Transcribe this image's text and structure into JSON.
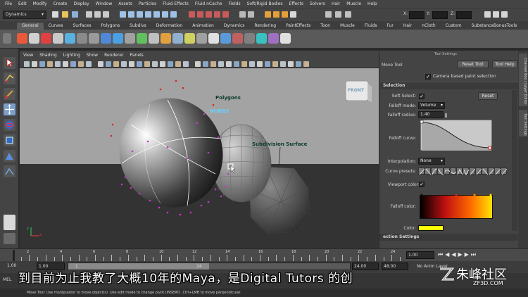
{
  "menubar": [
    "File",
    "Edit",
    "Modify",
    "Create",
    "Display",
    "Window",
    "Assets",
    "Particles",
    "Fluid Effects",
    "Fluid nCache",
    "Fields",
    "Soft/Rigid Bodies",
    "Effects",
    "Solvers",
    "Hair",
    "Muscle",
    "Help"
  ],
  "status": {
    "mode": "Dynamics",
    "x_label": "X:",
    "y_label": "Y:",
    "z_label": "Z:"
  },
  "shelf_tabs": [
    "General",
    "Curves",
    "Surfaces",
    "Polygons",
    "Subdivs",
    "Deformation",
    "Animation",
    "Dynamics",
    "Rendering",
    "PaintEffects",
    "Toon",
    "Muscle",
    "Fluids",
    "Fur",
    "Hair",
    "nCloth",
    "Custom",
    "SubstanceBonusTools"
  ],
  "shelf_active": "General",
  "viewport": {
    "menus": [
      "View",
      "Shading",
      "Lighting",
      "Show",
      "Renderer",
      "Panels"
    ],
    "labels": {
      "polygons": "Polygons",
      "nurbs": "NURBS",
      "subdiv": "Subdivision Surface",
      "cube": "FRONT"
    },
    "colors": {
      "background": "#a3a3a3",
      "ground": "#333333",
      "nurbs_label": "#6ad0ff",
      "label": "#0a3a2a"
    }
  },
  "tool_settings": {
    "panel_title": "Tool Settings",
    "tool_name": "Move Tool",
    "reset_tool": "Reset Tool",
    "tool_help": "Tool Help",
    "camera_based_paint": "Camera based paint selection",
    "section_selection": "Selection",
    "soft_select_label": "Soft Select:",
    "reset_button": "Reset",
    "falloff_mode_label": "Falloff mode:",
    "falloff_mode_value": "Volume",
    "falloff_radius_label": "Falloff radius:",
    "falloff_radius_value": "1.40",
    "falloff_curve_label": "Falloff curve:",
    "interpolation_label": "Interpolation:",
    "interpolation_value": "None",
    "curve_presets_label": "Curve presets:",
    "viewport_color_label": "Viewport color:",
    "falloff_color_label": "Falloff color:",
    "color_label": "Color:",
    "section_next": "ection Settings",
    "color_value": "#ffff00"
  },
  "sidetabs": [
    "Channel Box / Layer Editor",
    "Tool Settings"
  ],
  "timeslider": {
    "ticks": [
      "2",
      "4",
      "6",
      "8",
      "10",
      "12",
      "14",
      "16",
      "18",
      "20",
      "22",
      "24"
    ],
    "current": "1.00"
  },
  "range": {
    "start": "1.00",
    "start2": "1.00",
    "frame": "1",
    "end_field": "24",
    "end": "24.00",
    "end2": "48.00",
    "anim_layer": "No Anim Layer"
  },
  "cmd_label": "MEL",
  "helpline": "Move Tool: Use manipulator to move object(s). Use edit mode to change pivot (INSERT). Ctrl+LMB to move perpendicular.",
  "subtitle": "到目前为止我教了大概10年的Maya，是Digital Tutors 的创",
  "watermark": "朱峰社区",
  "watermark_url": "ZF3D.COM"
}
